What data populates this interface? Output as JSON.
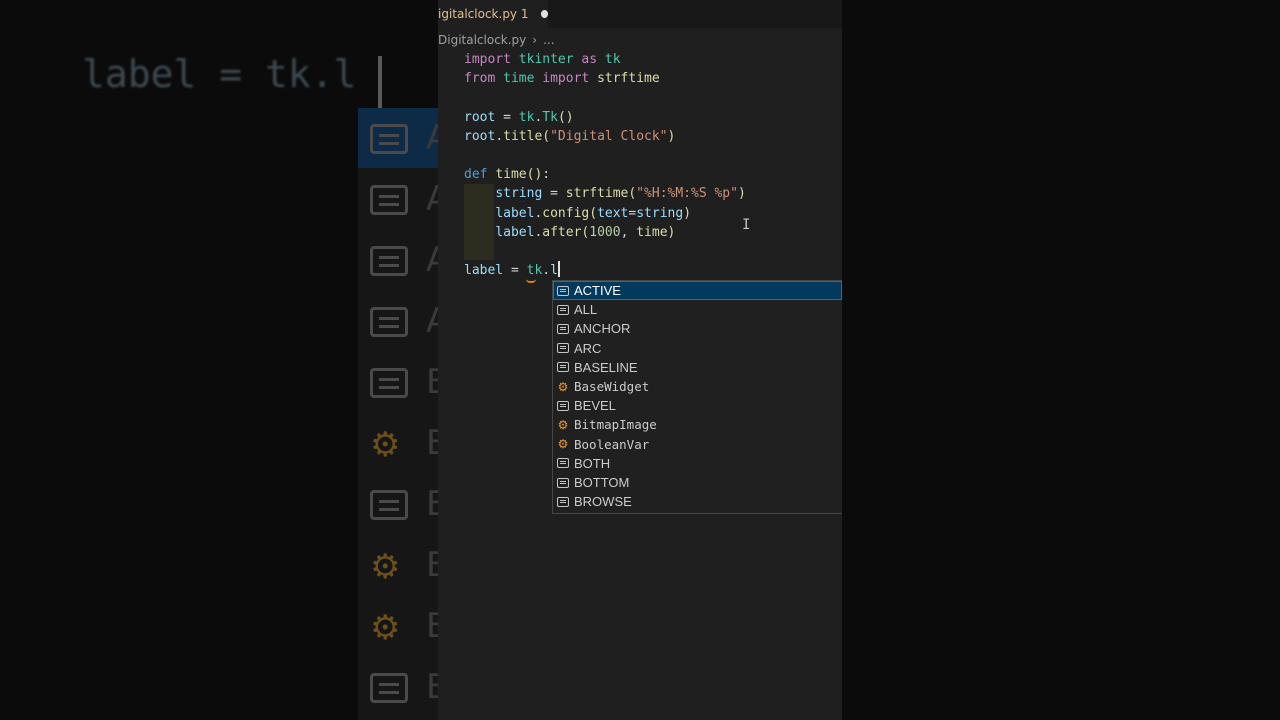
{
  "background": {
    "zoomed_code": "label = tk.l",
    "zoomed_letters": [
      "A",
      "A",
      "A",
      "A",
      "B",
      "B",
      "B",
      "B",
      "B",
      "B"
    ]
  },
  "editor": {
    "tab": {
      "filename": "igitalclock.py",
      "problem_count": "1"
    },
    "breadcrumb": {
      "file": "Digitalclock.py",
      "more": "..."
    },
    "code_lines": [
      "import tkinter as tk",
      "from time import strftime",
      "",
      "root = tk.Tk()",
      "root.title(\"Digital Clock\")",
      "",
      "def time():",
      "    string = strftime(\"%H:%M:%S %p\")",
      "    label.config(text=string)",
      "    label.after(1000, time)",
      "",
      "label = tk.l"
    ]
  },
  "suggest": {
    "selected_index": 0,
    "items": [
      {
        "label": "ACTIVE",
        "kind": "constant",
        "icon": "constant-icon"
      },
      {
        "label": "ALL",
        "kind": "constant",
        "icon": "constant-icon"
      },
      {
        "label": "ANCHOR",
        "kind": "constant",
        "icon": "constant-icon"
      },
      {
        "label": "ARC",
        "kind": "constant",
        "icon": "constant-icon"
      },
      {
        "label": "BASELINE",
        "kind": "constant",
        "icon": "constant-icon"
      },
      {
        "label": "BaseWidget",
        "kind": "class",
        "icon": "class-icon"
      },
      {
        "label": "BEVEL",
        "kind": "constant",
        "icon": "constant-icon"
      },
      {
        "label": "BitmapImage",
        "kind": "class",
        "icon": "class-icon"
      },
      {
        "label": "BooleanVar",
        "kind": "class",
        "icon": "class-icon"
      },
      {
        "label": "BOTH",
        "kind": "constant",
        "icon": "constant-icon"
      },
      {
        "label": "BOTTOM",
        "kind": "constant",
        "icon": "constant-icon"
      },
      {
        "label": "BROWSE",
        "kind": "constant",
        "icon": "constant-icon"
      }
    ]
  },
  "colors": {
    "editor_bg": "#1f1f1f",
    "selection": "#04395e",
    "selection_border": "#0078d4",
    "class_icon": "#ee9d28",
    "tab_modified": "#e2c08d"
  }
}
